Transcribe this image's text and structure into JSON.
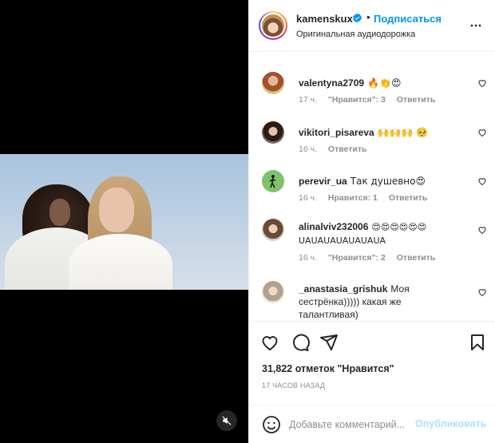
{
  "post": {
    "username": "kamenskux",
    "separator": "•",
    "follow_label": "Подписаться",
    "audio_label": "Оригинальная аудиодорожка"
  },
  "comments": [
    {
      "user": "valentyna2709",
      "text": "🔥👏😍",
      "time": "17 ч.",
      "likes": "\"Нравится\": 3",
      "reply": "Ответить"
    },
    {
      "user": "vikitori_pisareva",
      "text": "🙌🙌🙌 🥺",
      "time": "16 ч.",
      "likes": "",
      "reply": "Ответить"
    },
    {
      "user": "perevir_ua",
      "text": "Так душевно😍",
      "time": "16 ч.",
      "likes": "Нравится: 1",
      "reply": "Ответить"
    },
    {
      "user": "alinalviv232006",
      "text": "😍😍😍😍😍😍 UAUAUAUAUAUAUA",
      "time": "16 ч.",
      "likes": "\"Нравится\": 2",
      "reply": "Ответить"
    },
    {
      "user": "_anastasia_grishuk",
      "text": "Моя сестрёнка))))) какая же талантливая)",
      "time": "",
      "likes": "",
      "reply": ""
    }
  ],
  "likes_count": "31,822 отметок \"Нравится\"",
  "time_ago": "17 ЧАСОВ НАЗАД",
  "add_comment": {
    "placeholder": "Добавьте комментарий...",
    "publish_label": "Опубликовать"
  },
  "icons": {
    "like": "heart-icon",
    "comment": "comment-icon",
    "share": "share-icon",
    "save": "bookmark-icon",
    "more": "more-icon",
    "mute": "muted-speaker-icon",
    "emoji": "emoji-icon"
  },
  "colors": {
    "accent": "#0095f6",
    "publish_disabled": "#b2dffc",
    "muted_text": "#8e8e8e"
  }
}
